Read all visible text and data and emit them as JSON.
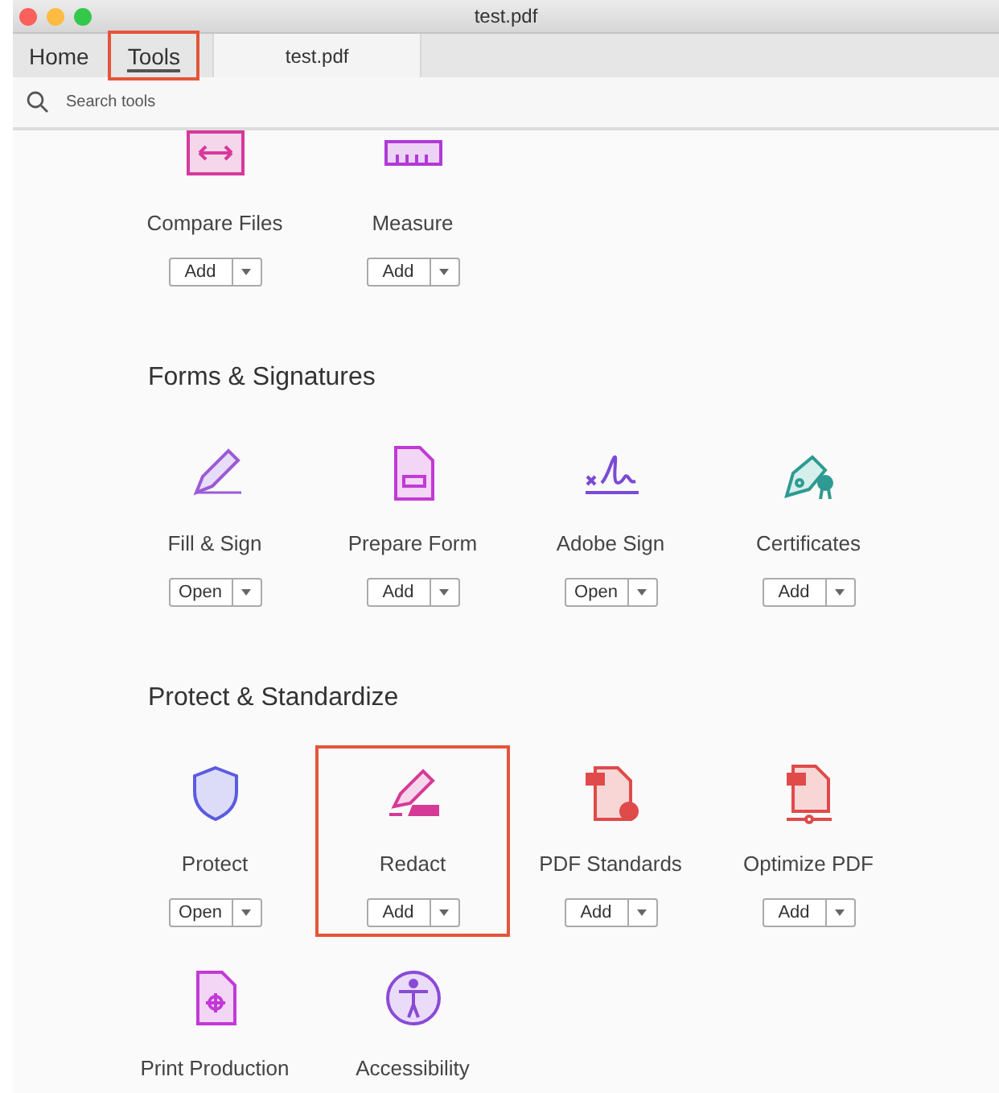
{
  "window": {
    "title": "test.pdf"
  },
  "tabs": [
    {
      "label": "Home",
      "selected": false,
      "highlighted": false
    },
    {
      "label": "Tools",
      "selected": true,
      "highlighted": true
    }
  ],
  "document_tab": {
    "label": "test.pdf"
  },
  "search": {
    "placeholder": "Search tools"
  },
  "sections": [
    {
      "tools": [
        {
          "name": "Compare Files",
          "action": "Add",
          "highlighted": false
        },
        {
          "name": "Measure",
          "action": "Add",
          "highlighted": false
        }
      ]
    },
    {
      "heading": "Forms & Signatures",
      "tools": [
        {
          "name": "Fill & Sign",
          "action": "Open",
          "highlighted": false
        },
        {
          "name": "Prepare Form",
          "action": "Add",
          "highlighted": false
        },
        {
          "name": "Adobe Sign",
          "action": "Open",
          "highlighted": false
        },
        {
          "name": "Certificates",
          "action": "Add",
          "highlighted": false
        }
      ]
    },
    {
      "heading": "Protect & Standardize",
      "tools": [
        {
          "name": "Protect",
          "action": "Open",
          "highlighted": false
        },
        {
          "name": "Redact",
          "action": "Add",
          "highlighted": true
        },
        {
          "name": "PDF Standards",
          "action": "Add",
          "highlighted": false
        },
        {
          "name": "Optimize PDF",
          "action": "Add",
          "highlighted": false
        },
        {
          "name": "Print Production",
          "highlighted": false
        },
        {
          "name": "Accessibility",
          "highlighted": false
        }
      ]
    }
  ]
}
